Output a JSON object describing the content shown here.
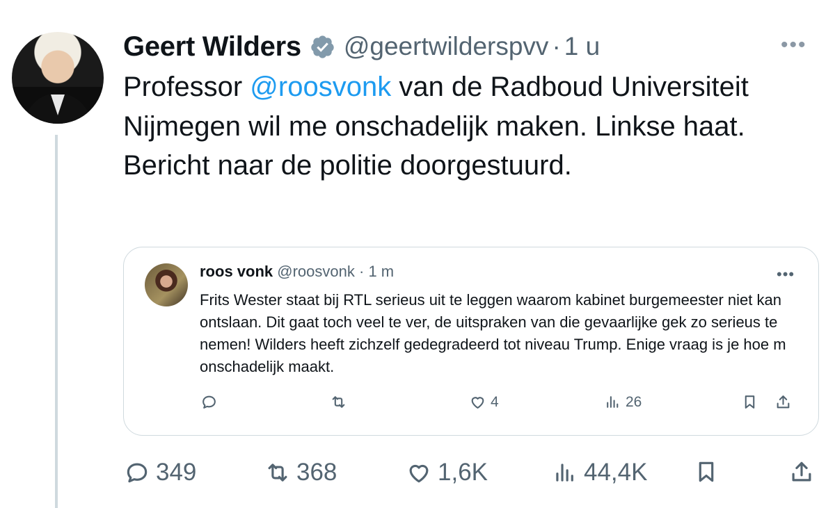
{
  "tweet": {
    "author_name": "Geert Wilders",
    "handle": "@geertwilderspvv",
    "separator": "·",
    "time": "1 u",
    "text_before": "Professor ",
    "mention": "@roosvonk",
    "text_after": " van de Radboud Universiteit Nijmegen wil me onschadelijk maken. Linkse haat. Bericht naar de politie doorgestuurd.",
    "more_label": "•••",
    "stats": {
      "replies": "349",
      "retweets": "368",
      "likes": "1,6K",
      "views": "44,4K"
    }
  },
  "quote": {
    "author_name": "roos vonk",
    "handle": "@roosvonk",
    "separator": "·",
    "time": "1 m",
    "more_label": "•••",
    "text": "Frits Wester staat bij RTL serieus uit te leggen waarom kabinet burgemeester niet kan ontslaan. Dit gaat toch veel te ver, de uitspraken van die gevaarlijke gek zo serieus te nemen! Wilders heeft zichzelf gedegradeerd tot niveau Trump. Enige vraag is je hoe m onschadelijk maakt.",
    "stats": {
      "likes": "4",
      "views": "26"
    }
  },
  "colors": {
    "verified_badge": "#829aab",
    "mention": "#1d9bf0",
    "secondary_text": "#536471",
    "border": "#cfd9de"
  },
  "icons": {
    "reply": "speech-bubble-icon",
    "retweet": "retweet-arrows-icon",
    "like": "heart-icon",
    "views": "bar-chart-icon",
    "bookmark": "bookmark-icon",
    "share": "share-upload-icon",
    "verified": "verified-badge-icon"
  }
}
